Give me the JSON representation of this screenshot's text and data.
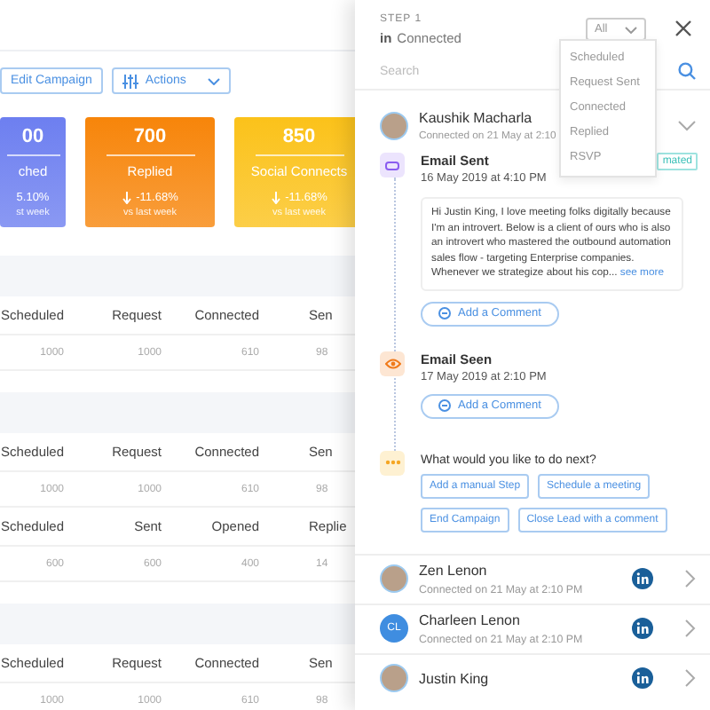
{
  "toolbar": {
    "buttons": [
      {
        "label": "Edit Campaign",
        "kind": "edit"
      },
      {
        "label": "Actions",
        "kind": "actions"
      }
    ]
  },
  "stat_cards": [
    {
      "value": "00",
      "label": "ched",
      "change": "5.10%",
      "arrow_down": false,
      "note": "st week",
      "color": "#6d7ff0"
    },
    {
      "value": "700",
      "label": "Replied",
      "change": "-11.68%",
      "arrow_down": true,
      "note": "vs last week",
      "color": "#f7850a"
    },
    {
      "value": "850",
      "label": "Social Connects",
      "change": "-11.68%",
      "arrow_down": true,
      "note": "vs last week",
      "color": "#fbc21a"
    }
  ],
  "groups": [
    {
      "tables": [
        {
          "columns": [
            "Scheduled",
            "Request",
            "Connected",
            "Sen"
          ],
          "rows": [
            [
              "1000",
              "1000",
              "610",
              "98"
            ]
          ]
        }
      ]
    },
    {
      "tables": [
        {
          "columns": [
            "Scheduled",
            "Request",
            "Connected",
            "Sen"
          ],
          "rows": [
            [
              "1000",
              "1000",
              "610",
              "98"
            ]
          ]
        },
        {
          "columns": [
            "Scheduled",
            "Sent",
            "Opened",
            "Replie"
          ],
          "rows": [
            [
              "600",
              "600",
              "400",
              "14"
            ]
          ]
        }
      ]
    },
    {
      "tables": [
        {
          "columns": [
            "Scheduled",
            "Request",
            "Connected",
            "Sen"
          ],
          "rows": [
            [
              "1000",
              "1000",
              "610",
              "98"
            ]
          ]
        }
      ]
    }
  ],
  "panel": {
    "step": "STEP 1",
    "network_label": "in",
    "status": "Connected",
    "filter": {
      "value": "All",
      "expanded": true,
      "options": [
        "Scheduled",
        "Request Sent",
        "Connected",
        "Replied",
        "RSVP"
      ]
    },
    "search": {
      "placeholder": "Search"
    },
    "active_lead": {
      "name": "Kaushik Macharla",
      "subtitle": "Connected on 21 May at 2:10",
      "photo": true,
      "expanded": true
    },
    "timeline": [
      {
        "kind": "email_sent",
        "title": "Email Sent",
        "time": "16 May 2019 at 4:10 PM",
        "badge": "mated",
        "message": "Hi Justin King, I love meeting folks digitally because I'm an introvert. Below is a client of ours who is also an introvert who mastered the outbound automation sales flow - targeting Enterprise companies. Whenever we strategize about his cop...",
        "link": "see more",
        "comment_button": "Add a Comment"
      },
      {
        "kind": "email_seen",
        "title": "Email Seen",
        "time": "17 May 2019 at 2:10 PM",
        "comment_button": "Add a Comment"
      },
      {
        "kind": "next",
        "question": "What would you like to do next?",
        "actions": [
          "Add a manual Step",
          "Schedule a meeting",
          "End Campaign",
          "Close Lead with a comment"
        ]
      }
    ],
    "leads": [
      {
        "name": "Zen Lenon",
        "subtitle": "Connected on 21 May at 2:10 PM",
        "photo": true
      },
      {
        "name": "Charleen Lenon",
        "subtitle": "Connected on 21 May at 2:10 PM",
        "photo": false,
        "initials": "CL"
      },
      {
        "name": "Justin King",
        "photo": true
      }
    ]
  }
}
